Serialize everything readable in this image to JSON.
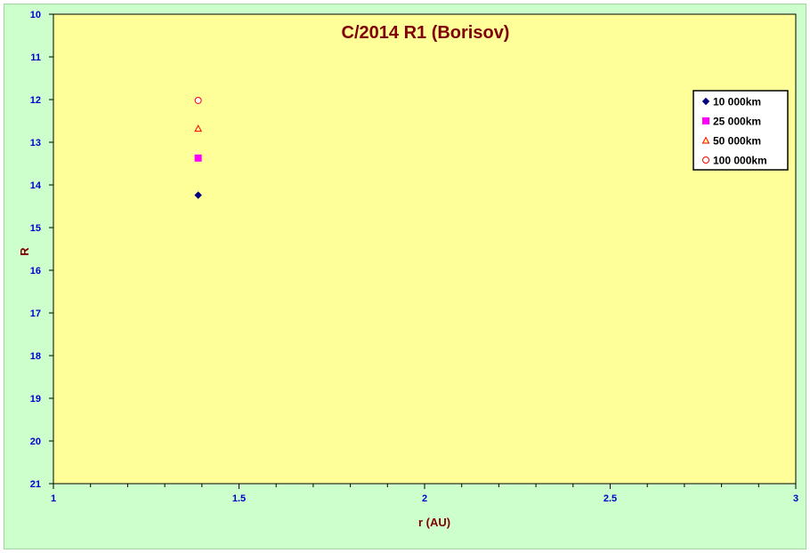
{
  "chart_data": {
    "type": "scatter",
    "title": "C/2014 R1 (Borisov)",
    "xlabel": "r (AU)",
    "ylabel": "R",
    "xlim": [
      1,
      3
    ],
    "ylim": [
      10,
      21
    ],
    "y_reversed": true,
    "x_ticks": [
      "1",
      "1.5",
      "2",
      "2.5",
      "3"
    ],
    "x_tick_values": [
      1,
      1.5,
      2,
      2.5,
      3
    ],
    "y_ticks": [
      "10",
      "11",
      "12",
      "13",
      "14",
      "15",
      "16",
      "17",
      "18",
      "19",
      "20",
      "21"
    ],
    "y_tick_values": [
      10,
      11,
      12,
      13,
      14,
      15,
      16,
      17,
      18,
      19,
      20,
      21
    ],
    "grid": false,
    "legend_position": "top-right",
    "plot_background": "#ffff99",
    "chart_background": "#ccffcc",
    "series": [
      {
        "name": "10 000km",
        "marker": "diamond",
        "color": "#000080",
        "fill": "#000080",
        "x": [
          1.39
        ],
        "y": [
          14.24
        ]
      },
      {
        "name": "25 000km",
        "marker": "square",
        "color": "#ff00ff",
        "fill": "#ff00ff",
        "x": [
          1.39
        ],
        "y": [
          13.37
        ]
      },
      {
        "name": "50 000km",
        "marker": "triangle",
        "color": "#ff0000",
        "fill": "#ffff99",
        "x": [
          1.39
        ],
        "y": [
          12.68
        ]
      },
      {
        "name": "100 000km",
        "marker": "circle",
        "color": "#ff0000",
        "fill": "#ffffff",
        "x": [
          1.39
        ],
        "y": [
          12.02
        ]
      }
    ]
  }
}
